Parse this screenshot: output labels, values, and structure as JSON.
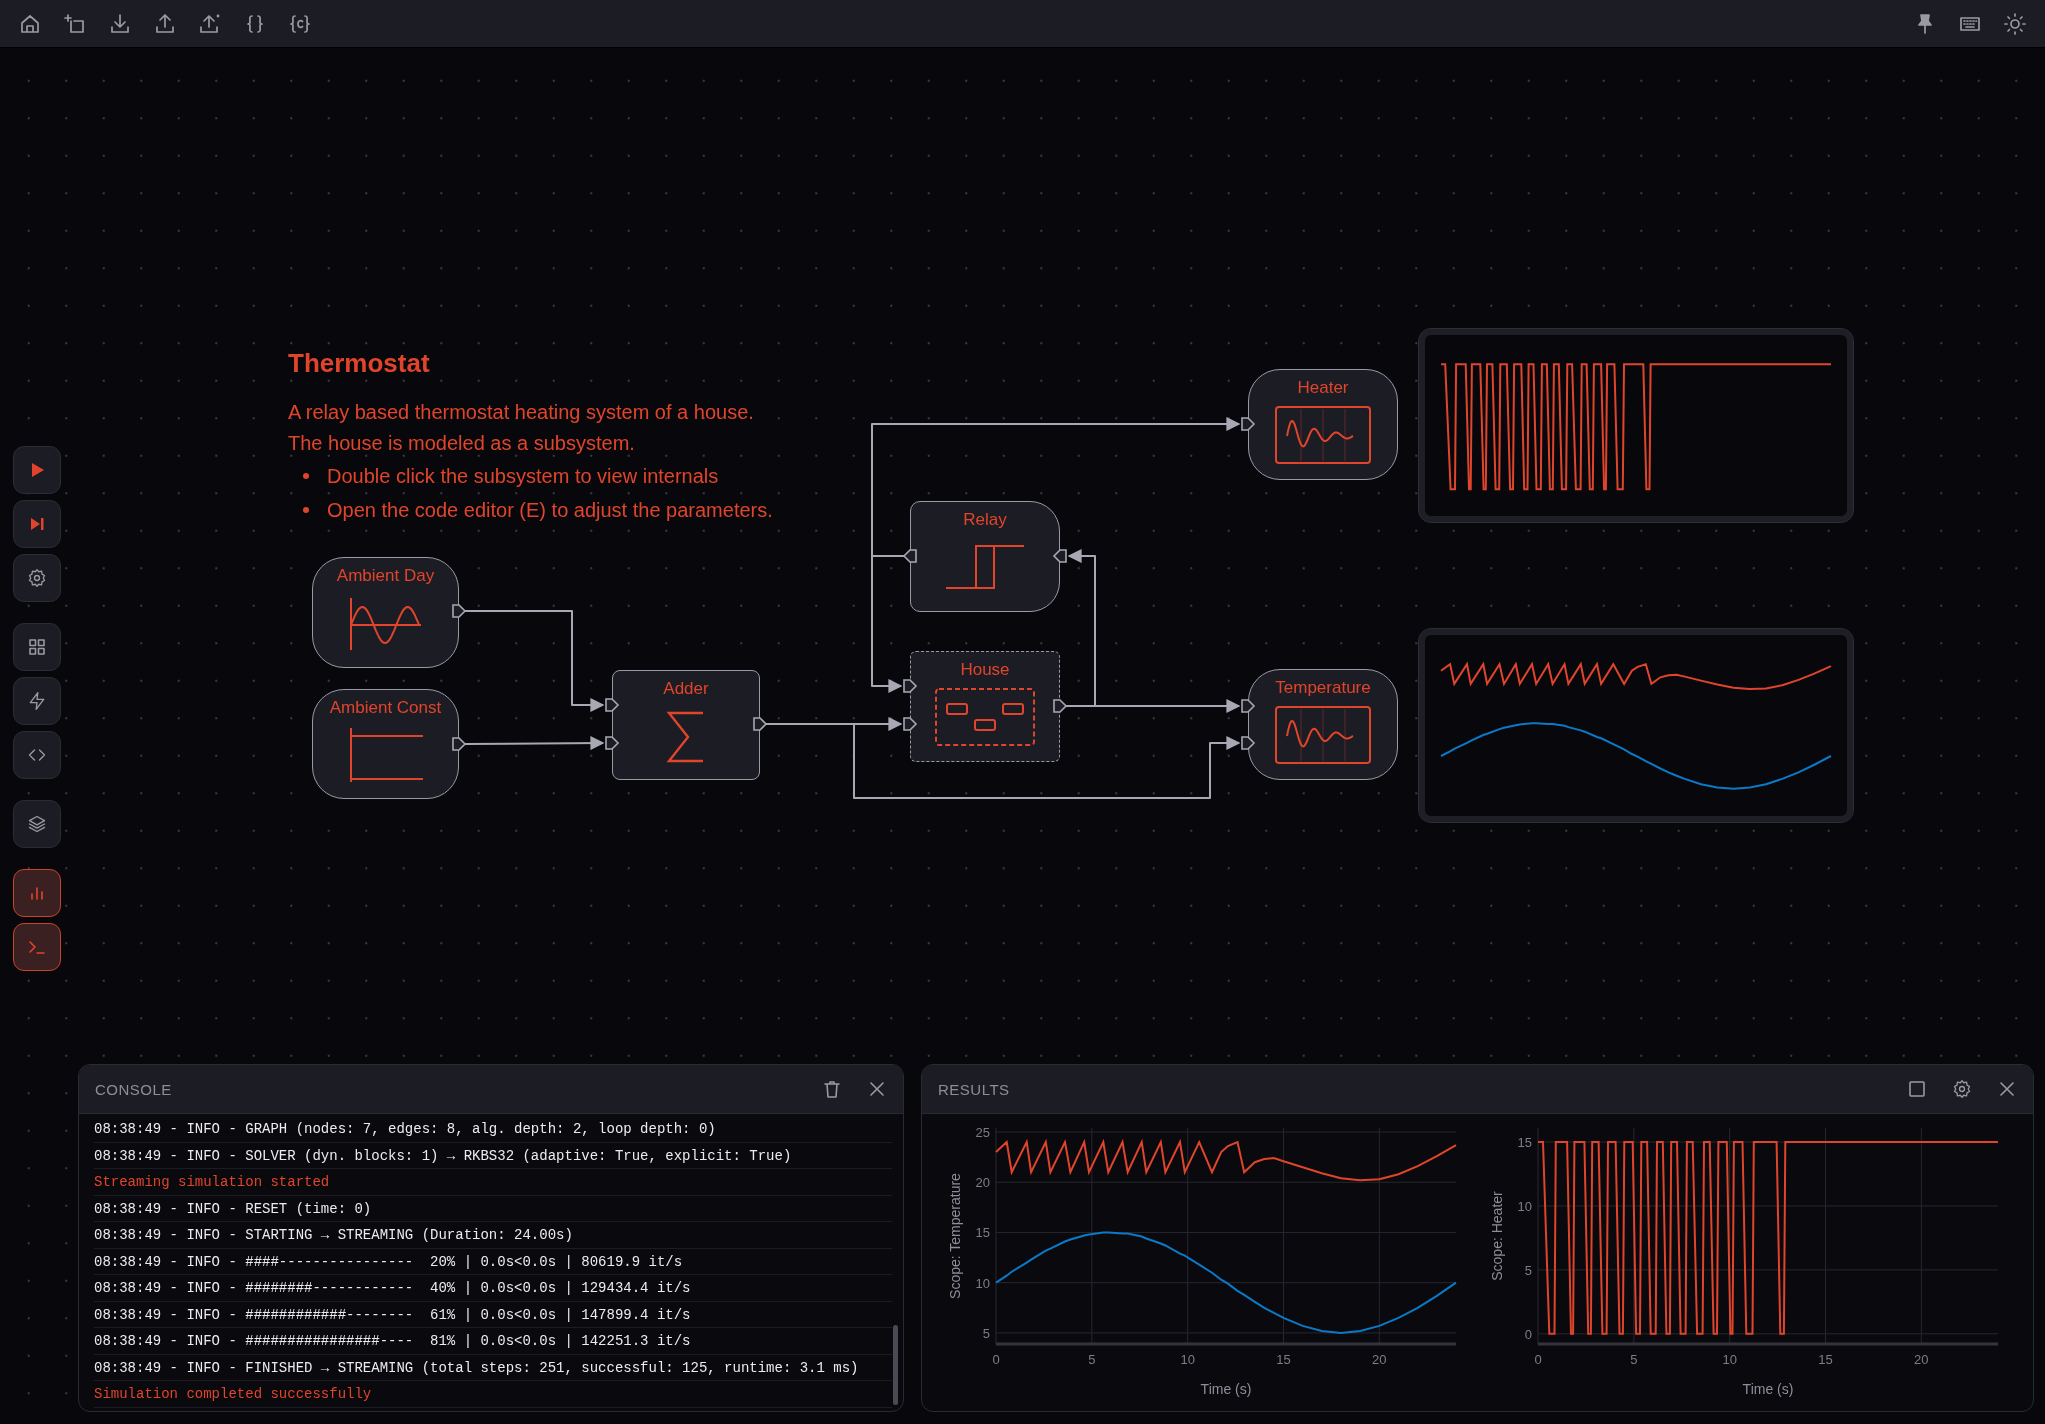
{
  "side_toolbar": [
    {
      "selected": false
    },
    {
      "selected": false
    },
    {
      "selected": false
    },
    {
      "selected": false
    },
    {
      "selected": false
    },
    {
      "selected": false
    },
    {
      "selected": false
    },
    {
      "selected": true
    },
    {
      "selected": true
    }
  ],
  "annotation": {
    "title": "Thermostat",
    "lines": [
      "A relay based thermostat heating system of a house.",
      "The house is modeled as a subsystem."
    ],
    "bullets": [
      "Double click the subsystem to view internals",
      "Open the code editor (E) to adjust the parameters."
    ]
  },
  "blocks": [
    {
      "label": "Ambient Day",
      "kind": "sine"
    },
    {
      "label": "Ambient Const",
      "kind": "constant"
    },
    {
      "label": "Adder",
      "kind": "adder"
    },
    {
      "label": "Relay",
      "kind": "relay"
    },
    {
      "label": "House",
      "kind": "subsystem"
    },
    {
      "label": "Heater",
      "kind": "scope"
    },
    {
      "label": "Temperature",
      "kind": "scope"
    }
  ],
  "console": {
    "title": "CONSOLE",
    "lines": [
      {
        "kind": "info",
        "text": "08:38:49 - INFO - GRAPH (nodes: 7, edges: 8, alg. depth: 2, loop depth: 0)"
      },
      {
        "kind": "info",
        "text": "08:38:49 - INFO - SOLVER (dyn. blocks: 1) → RKBS32 (adaptive: True, explicit: True)"
      },
      {
        "kind": "status",
        "text": "Streaming simulation started"
      },
      {
        "kind": "info",
        "text": "08:38:49 - INFO - RESET (time: 0)"
      },
      {
        "kind": "info",
        "text": "08:38:49 - INFO - STARTING → STREAMING (Duration: 24.00s)"
      },
      {
        "kind": "info",
        "text": "08:38:49 - INFO - ####----------------  20% | 0.0s<0.0s | 80619.9 it/s"
      },
      {
        "kind": "info",
        "text": "08:38:49 - INFO - ########------------  40% | 0.0s<0.0s | 129434.4 it/s"
      },
      {
        "kind": "info",
        "text": "08:38:49 - INFO - ############--------  61% | 0.0s<0.0s | 147899.4 it/s"
      },
      {
        "kind": "info",
        "text": "08:38:49 - INFO - ################----  81% | 0.0s<0.0s | 142251.3 it/s"
      },
      {
        "kind": "info",
        "text": "08:38:49 - INFO - FINISHED → STREAMING (total steps: 251, successful: 125, runtime: 3.1 ms)"
      },
      {
        "kind": "status",
        "text": "Simulation completed successfully"
      }
    ]
  },
  "results": {
    "title": "RESULTS",
    "charts": [
      {
        "chart_data": {
          "type": "line",
          "xlabel": "Time (s)",
          "ylabel": "Scope: Temperature",
          "xlim": [
            0,
            24
          ],
          "ylim": [
            3.9,
            25.4
          ],
          "xticks": [
            0,
            5,
            10,
            15,
            20
          ],
          "yticks": [
            5,
            10,
            15,
            20,
            25
          ],
          "grid": true,
          "x": [
            0,
            0.56,
            0.82,
            1.6,
            1.83,
            2.6,
            2.84,
            3.6,
            3.88,
            4.6,
            4.85,
            5.6,
            5.86,
            6.6,
            6.87,
            7.6,
            7.84,
            8.6,
            8.84,
            9.6,
            9.85,
            10.6,
            11.27,
            11.75,
            12.1,
            12.6,
            12.95,
            13.5,
            14,
            14.5,
            15,
            16,
            17,
            18,
            19,
            20,
            21,
            22,
            23,
            24
          ],
          "series": [
            {
              "color": "#e0452c",
              "values": [
                23,
                24,
                21,
                24,
                21,
                24,
                21,
                24,
                21,
                24,
                21,
                24,
                21,
                24,
                21,
                24,
                21,
                24,
                21,
                24,
                21,
                24,
                21,
                23.0,
                23.6,
                24.0,
                21.0,
                22.0,
                22.3,
                22.4,
                22.1,
                21.5,
                20.9,
                20.4,
                20.2,
                20.3,
                20.8,
                21.6,
                22.6,
                23.7
              ]
            },
            {
              "color": "#0a7ac8",
              "values": [
                10,
                10.7,
                11.1,
                12,
                12.3,
                13.2,
                13.4,
                14.1,
                14.3,
                14.7,
                14.8,
                15,
                15,
                14.9,
                14.9,
                14.6,
                14.4,
                13.9,
                13.7,
                12.9,
                12.7,
                11.8,
                11,
                10.3,
                9.9,
                9.2,
                8.8,
                8.1,
                7.5,
                7,
                6.5,
                5.7,
                5.2,
                5,
                5.2,
                5.7,
                6.5,
                7.5,
                8.7,
                10
              ]
            }
          ]
        }
      },
      {
        "chart_data": {
          "type": "line",
          "xlabel": "Time (s)",
          "ylabel": "Scope: Heater",
          "xlim": [
            0,
            24
          ],
          "ylim": [
            -0.8,
            16.1
          ],
          "xticks": [
            0,
            5,
            10,
            15,
            20
          ],
          "yticks": [
            0,
            5,
            10,
            15
          ],
          "grid": true,
          "x": [
            0,
            0.26,
            0.59,
            0.86,
            0.93,
            1.52,
            1.72,
            1.83,
            1.9,
            2.42,
            2.62,
            2.76,
            2.83,
            3.16,
            3.36,
            3.58,
            3.65,
            4.05,
            4.25,
            4.43,
            4.5,
            4.94,
            5.12,
            5.32,
            5.39,
            5.69,
            5.88,
            6.14,
            6.21,
            6.51,
            6.7,
            6.88,
            6.95,
            7.25,
            7.44,
            7.7,
            7.77,
            8.07,
            8.3,
            8.59,
            8.66,
            8.96,
            9.16,
            9.34,
            9.41,
            9.85,
            10.04,
            10.15,
            10.22,
            10.67,
            10.87,
            11.19,
            11.26,
            12.45,
            12.64,
            12.83,
            12.9,
            24
          ],
          "series": [
            {
              "color": "#e0452c",
              "values": [
                15,
                15,
                0,
                0,
                15,
                15,
                0,
                0,
                15,
                15,
                0,
                0,
                15,
                15,
                0,
                0,
                15,
                15,
                0,
                0,
                15,
                15,
                0,
                0,
                15,
                15,
                0,
                0,
                15,
                15,
                0,
                0,
                15,
                15,
                0,
                0,
                15,
                15,
                0,
                0,
                15,
                15,
                0,
                0,
                15,
                15,
                0,
                0,
                15,
                15,
                0,
                0,
                15,
                15,
                0,
                0,
                15,
                15
              ]
            }
          ]
        }
      }
    ]
  }
}
